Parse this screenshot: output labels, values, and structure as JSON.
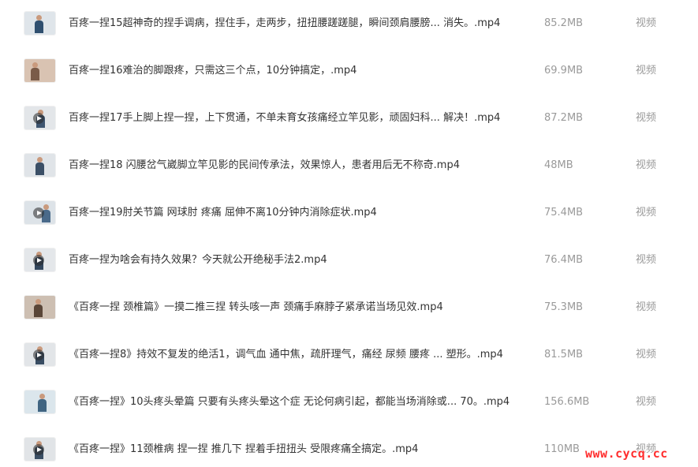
{
  "files": [
    {
      "name": "百疼一捏15超神奇的捏手调病，捏住手，走两步，扭扭腰蹉蹉腿，瞬间颈肩腰膀...  消失。.mp4",
      "size": "85.2MB",
      "type": "视频",
      "thumb_bg": "#dfe5ea",
      "shirt": "#2f4f6f",
      "play": false
    },
    {
      "name": "百疼一捏16难治的脚跟疼，只需这三个点，10分钟搞定，.mp4",
      "size": "69.9MB",
      "type": "视频",
      "thumb_bg": "#d9c3b2",
      "shirt": "#7a5b48",
      "play": false
    },
    {
      "name": "百疼一捏17手上脚上捏一捏，上下贯通，不单未育女孩痛经立竿见影，顽固妇科...  解决！.mp4",
      "size": "87.2MB",
      "type": "视频",
      "thumb_bg": "#e3e6e9",
      "shirt": "#3e5570",
      "play": true
    },
    {
      "name": "百疼一捏18 闪腰岔气崴脚立竿见影的民间传承法，效果惊人，患者用后无不称奇.mp4",
      "size": "48MB",
      "type": "视频",
      "thumb_bg": "#e0e4e8",
      "shirt": "#3b4f66",
      "play": false
    },
    {
      "name": "百疼一捏19肘关节篇 网球肘 疼痛 屈伸不离10分钟内消除症状.mp4",
      "size": "75.4MB",
      "type": "视频",
      "thumb_bg": "#dde3e8",
      "shirt": "#4a6a8a",
      "play": true
    },
    {
      "name": "百疼一捏为啥会有持久效果？今天就公开绝秘手法2.mp4",
      "size": "76.4MB",
      "type": "视频",
      "thumb_bg": "#e4e7ea",
      "shirt": "#34485e",
      "play": true
    },
    {
      "name": "《百疼一捏 颈椎篇》一摸二推三捏 转头咳一声 颈痛手麻脖子紧承诺当场见效.mp4",
      "size": "75.3MB",
      "type": "视频",
      "thumb_bg": "#cdbfb2",
      "shirt": "#5a4638",
      "play": false
    },
    {
      "name": "《百疼一捏8》持效不复发的绝活1，调气血  通中焦，疏肝理气，痛经 尿频 腰疼 ...  塑形。.mp4",
      "size": "81.5MB",
      "type": "视频",
      "thumb_bg": "#e2e5e8",
      "shirt": "#394d63",
      "play": true
    },
    {
      "name": "《百疼一捏》10头疼头晕篇 只要有头疼头晕这个症 无论何病引起，都能当场消除或... 70。.mp4",
      "size": "156.6MB",
      "type": "视频",
      "thumb_bg": "#dbe6ec",
      "shirt": "#406582",
      "play": false
    },
    {
      "name": "《百疼一捏》11颈椎病 捏一捏 推几下 捏着手扭扭头 受限疼痛全搞定。.mp4",
      "size": "110MB",
      "type": "视频",
      "thumb_bg": "#e1e4e7",
      "shirt": "#3a4e64",
      "play": true
    }
  ],
  "watermark": "www.cycq.cc"
}
